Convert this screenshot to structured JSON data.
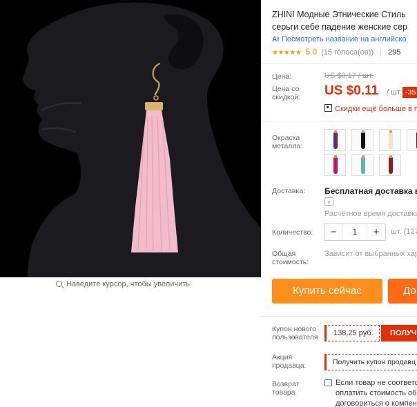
{
  "gallery": {
    "zoom_hint": "Наведите курсор, чтобы увеличить"
  },
  "product": {
    "title_line1": "ZHINI Модные Этнические Стиль",
    "title_line2": "серьги себе падение женские сер",
    "translate_link": "Посмотреть название на английско",
    "translate_icon": "AI",
    "rating_stars": "★★★★★",
    "rating_score": "5.0",
    "rating_votes": "(15 голоса(ов))",
    "rating_sep": "|",
    "orders": "295"
  },
  "price": {
    "label_price": "Цена:",
    "label_discount_line1": "Цена со",
    "label_discount_line2": "скидкой:",
    "old_price": "US $0.17 / шт.",
    "new_price": "US $0.11",
    "per_unit": "/ шт.",
    "discount_badge": "-35",
    "qr_promo": "Скидки ещё больше в п"
  },
  "options": {
    "color_label_line1": "Окраска",
    "color_label_line2": "металла:",
    "swatches": [
      {
        "name": "purple",
        "color": "#5b2a86"
      },
      {
        "name": "black",
        "color": "#111111"
      },
      {
        "name": "cream",
        "color": "#efe6c8"
      },
      {
        "name": "navy",
        "color": "#1d2a5e"
      },
      {
        "name": "rose",
        "color": "#c2185b"
      },
      {
        "name": "mint",
        "color": "#5fb7a0"
      },
      {
        "name": "wine",
        "color": "#8e1b1b"
      }
    ]
  },
  "shipping": {
    "label": "Доставка:",
    "method": "Бесплатная доставка в Ru",
    "toggle_glyph": "⌄",
    "estimate": "Расчётное время доставки"
  },
  "quantity": {
    "label": "Количество:",
    "minus": "−",
    "value": "1",
    "plus": "+",
    "unit": "шт. (127"
  },
  "total": {
    "label_line1": "Общая",
    "label_line2": "стоимость:",
    "value": "Зависит от выбранных хар"
  },
  "actions": {
    "buy_now": "Купить сейчас",
    "add_to_cart": "До"
  },
  "coupons": {
    "new_user_label_line1": "Купон нового",
    "new_user_label_line2": "пользователя",
    "new_user_value": "138,25 руб.",
    "new_user_get": "ПОЛУЧ",
    "seller_label_line1": "Акция",
    "seller_label_line2": "продавца:",
    "seller_button": "Получить купон продавц"
  },
  "returns": {
    "label_line1": "Возврат",
    "label_line2": "товара",
    "text_line1": "Если товар не соответс",
    "text_line2": "оплатить стоимость обр",
    "text_line3": "договориться о компен"
  }
}
